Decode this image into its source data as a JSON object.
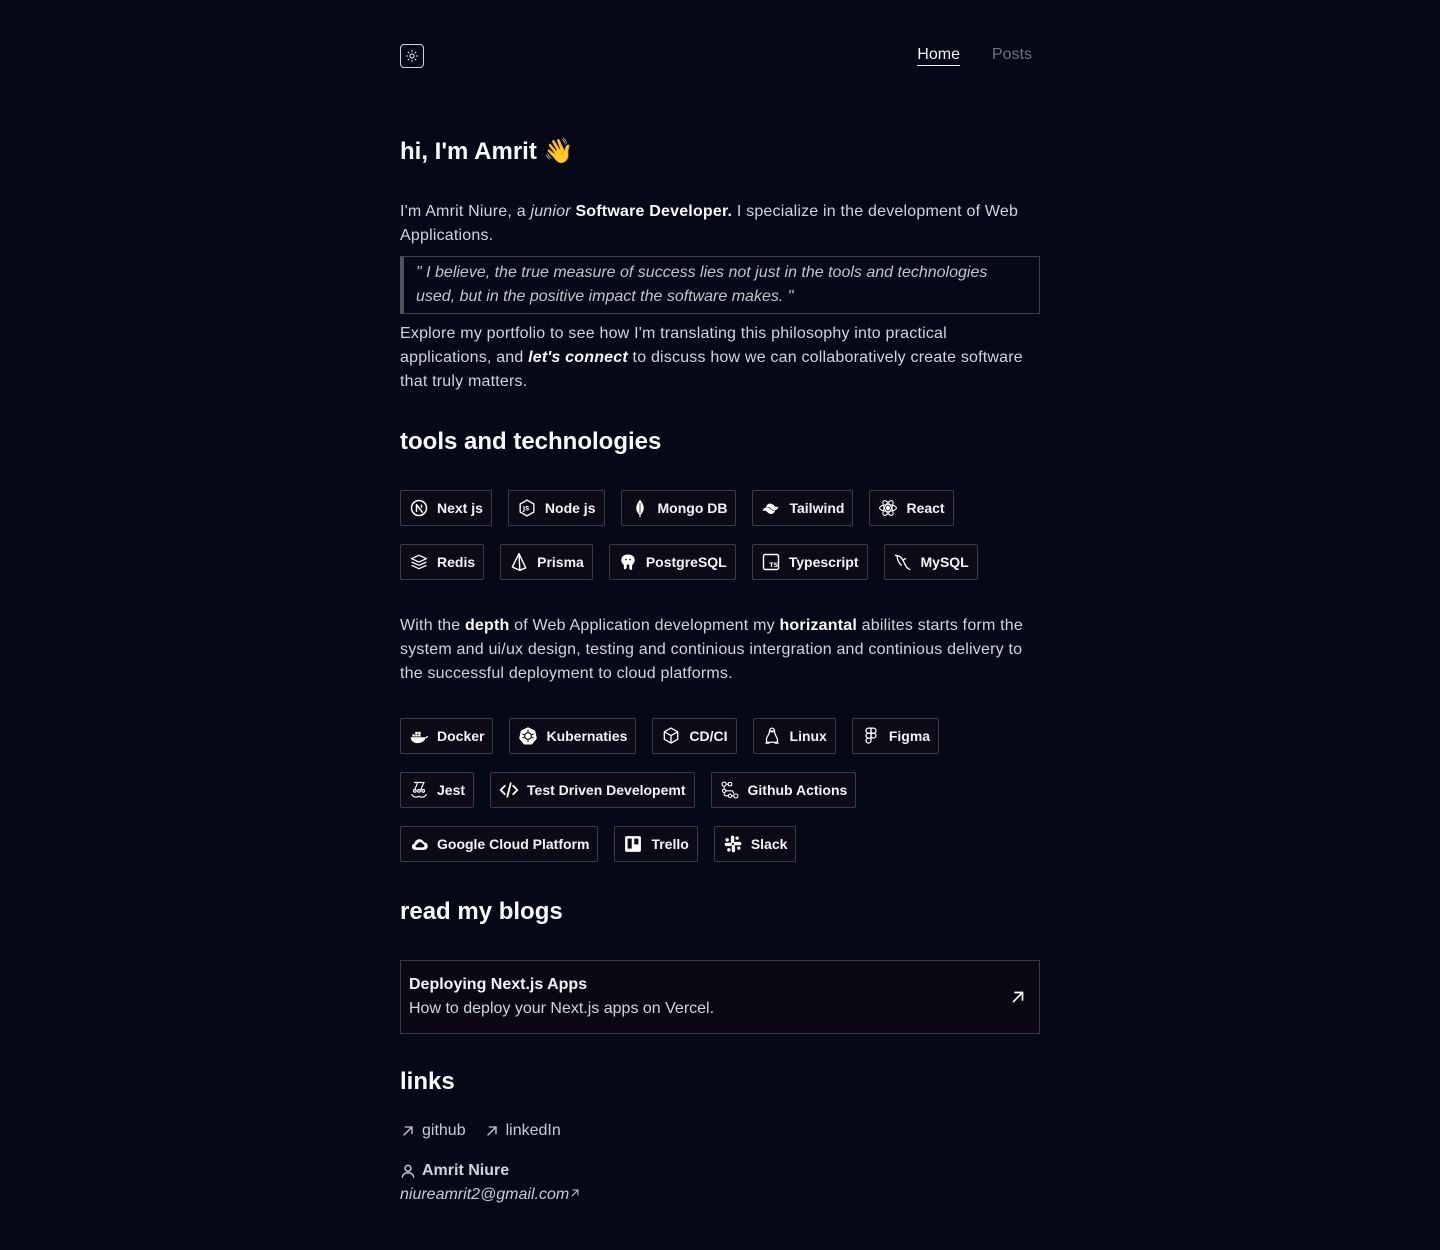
{
  "nav": {
    "theme_icon": "sun-icon",
    "links": [
      "Home",
      "Posts"
    ]
  },
  "hero": {
    "title": "hi, I'm Amrit 👋",
    "intro_prefix": "I'm Amrit Niure, a ",
    "intro_junior": "junior",
    "intro_role": "Software Developer.",
    "intro_suffix": " I specialize in the development of Web Applications.",
    "quote": "\" I believe, the true measure of success lies not just in the tools and technologies used, but in the positive impact the software makes. \"",
    "explore_prefix": "Explore my portfolio to see how I'm translating this philosophy into practical applications, and ",
    "explore_connect": "let's connect",
    "explore_suffix": " to discuss how we can collaboratively create software that truly matters."
  },
  "tools": {
    "title": "tools and technologies",
    "row1": [
      {
        "label": "Next js",
        "icon": "nextjs-icon"
      },
      {
        "label": "Node js",
        "icon": "nodejs-icon"
      },
      {
        "label": "Mongo DB",
        "icon": "mongodb-icon"
      },
      {
        "label": "Tailwind",
        "icon": "tailwind-icon"
      },
      {
        "label": "React",
        "icon": "react-icon"
      }
    ],
    "row2": [
      {
        "label": "Redis",
        "icon": "redis-icon"
      },
      {
        "label": "Prisma",
        "icon": "prisma-icon"
      },
      {
        "label": "PostgreSQL",
        "icon": "postgresql-icon"
      },
      {
        "label": "Typescript",
        "icon": "typescript-icon"
      },
      {
        "label": "MySQL",
        "icon": "mysql-icon"
      }
    ]
  },
  "depth": {
    "p1": "With the ",
    "depth": "depth",
    "p2": " of Web Application development my ",
    "horizantal": "horizantal",
    "p3": " abilites starts form the system and ui/ux design, testing and continious intergration and continious delivery to the successful deployment to cloud platforms."
  },
  "skills": {
    "row1": [
      {
        "label": "Docker",
        "icon": "docker-icon"
      },
      {
        "label": "Kubernaties",
        "icon": "kubernetes-icon"
      },
      {
        "label": "CD/CI",
        "icon": "cube-icon"
      },
      {
        "label": "Linux",
        "icon": "linux-icon"
      },
      {
        "label": "Figma",
        "icon": "figma-icon"
      }
    ],
    "row2": [
      {
        "label": "Jest",
        "icon": "jest-icon"
      },
      {
        "label": "Test Driven Developemt",
        "icon": "code-icon"
      },
      {
        "label": "Github Actions",
        "icon": "github-actions-icon"
      }
    ],
    "row3": [
      {
        "label": "Google Cloud Platform",
        "icon": "cloud-icon"
      },
      {
        "label": "Trello",
        "icon": "trello-icon"
      },
      {
        "label": "Slack",
        "icon": "slack-icon"
      }
    ]
  },
  "blogs": {
    "title": "read my blogs",
    "post_title": "Deploying Next.js Apps",
    "post_desc": "How to deploy your Next.js apps on Vercel."
  },
  "links": {
    "title": "links",
    "items": [
      "github",
      "linkedIn"
    ],
    "owner": "Amrit Niure",
    "email": "niureamrit2@gmail.com"
  }
}
